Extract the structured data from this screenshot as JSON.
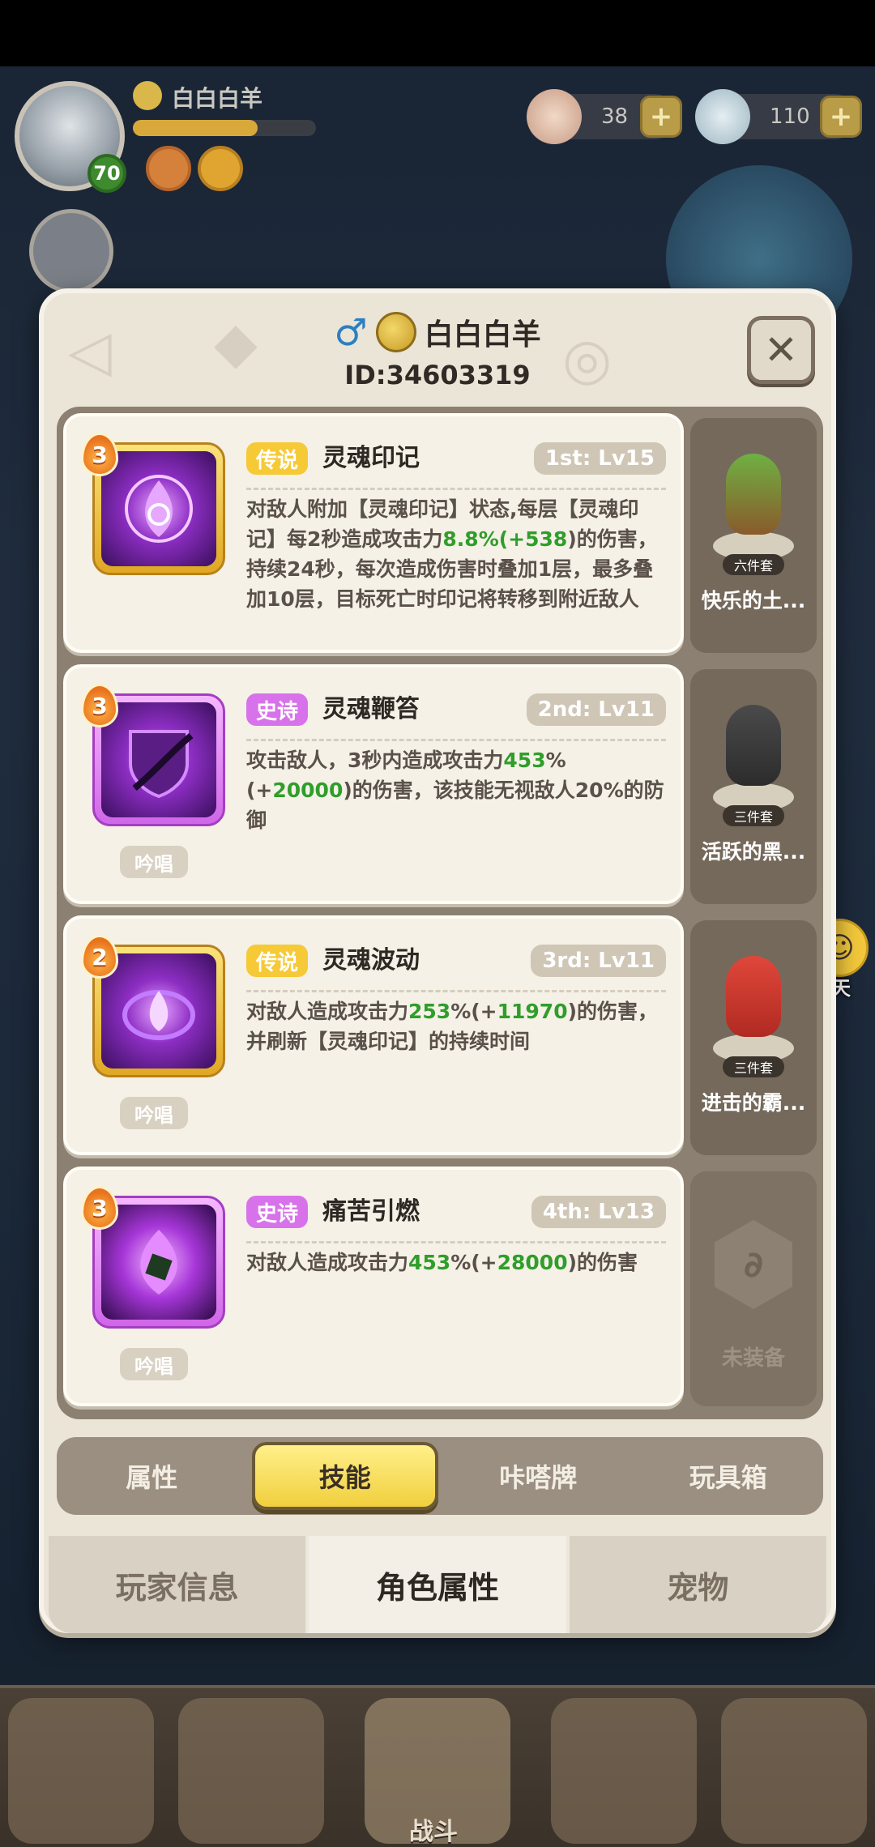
{
  "hud": {
    "player_name": "白白白羊",
    "level": "70",
    "currency_1": "38",
    "currency_2": "110",
    "plus": "+",
    "exp_progress": 0.68
  },
  "dialog": {
    "gender_icon": "♂",
    "player_name": "白白白羊",
    "player_id": "ID:34603319",
    "close_label": "✕"
  },
  "skills": [
    {
      "level": "3",
      "rarity": "传说",
      "name": "灵魂印记",
      "slot": "1st: Lv15",
      "desc_parts": [
        "对敌人附加【灵魂印记】状态,每层【灵魂印记】每2秒造成攻击力",
        "8.8",
        "%(+",
        "538",
        ")的伤害，持续24秒，每次造成伤害时叠加1层，最多叠加10层，目标死亡时印记将转移到附近敌人"
      ],
      "chant": ""
    },
    {
      "level": "3",
      "rarity": "史诗",
      "name": "灵魂鞭笞",
      "slot": "2nd: Lv11",
      "desc_parts": [
        "攻击敌人，3秒内造成攻击力",
        "453",
        "%(+",
        "20000",
        ")的伤害，该技能无视敌人20%的防御"
      ],
      "chant": "吟唱"
    },
    {
      "level": "2",
      "rarity": "传说",
      "name": "灵魂波动",
      "slot": "3rd: Lv11",
      "desc_parts": [
        "对敌人造成攻击力",
        "253",
        "%(+",
        "11970",
        ")的伤害，并刷新【灵魂印记】的持续时间"
      ],
      "chant": "吟唱"
    },
    {
      "level": "3",
      "rarity": "史诗",
      "name": "痛苦引燃",
      "slot": "4th: Lv13",
      "desc_parts": [
        "对敌人造成攻击力",
        "453",
        "%(+",
        "28000",
        ")的伤害"
      ],
      "chant": "吟唱"
    }
  ],
  "sets": [
    {
      "tag": "六件套",
      "name": "快乐的土..."
    },
    {
      "tag": "三件套",
      "name": "活跃的黑..."
    },
    {
      "tag": "三件套",
      "name": "进击的霸..."
    },
    {
      "tag": "",
      "name": "未装备"
    }
  ],
  "subtabs": [
    "属性",
    "技能",
    "咔嗒牌",
    "玩具箱"
  ],
  "maintabs": [
    "玩家信息",
    "角色属性",
    "宠物"
  ],
  "chat_label": "聊天",
  "bottom_nav_label": "战斗",
  "colors": {
    "legend": "#f6c936",
    "epic": "#d772ea",
    "highlight_green": "#2f9e2a",
    "active_subtab": "#f1cf3e"
  }
}
